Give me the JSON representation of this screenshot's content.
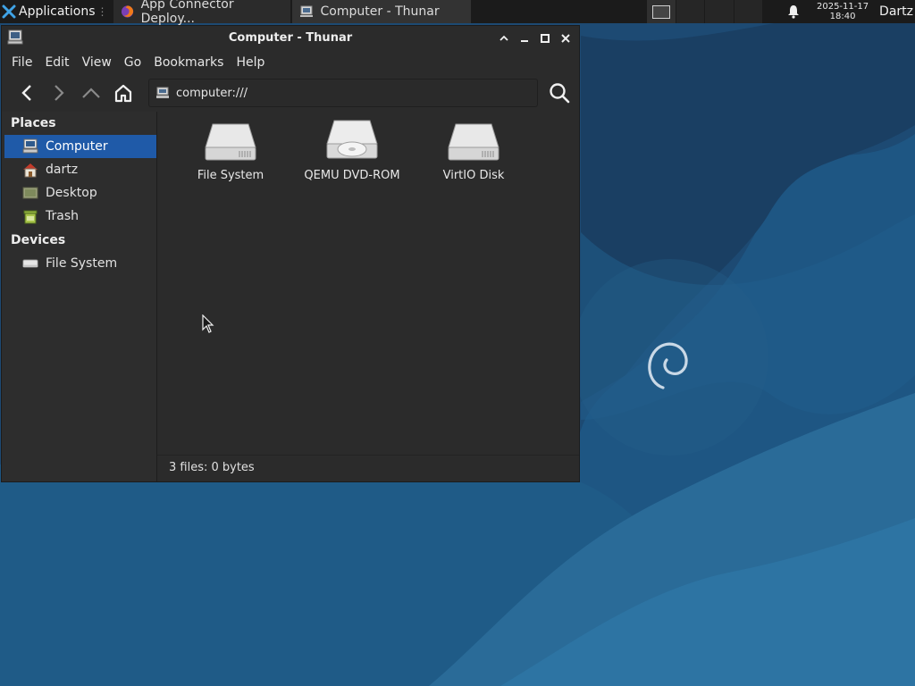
{
  "colors": {
    "panel": "#1b1b1b",
    "window_bg": "#2b2b2b",
    "selection": "#1f5aa8",
    "desktop": "#1f5a85"
  },
  "panel": {
    "applications_label": "Applications",
    "tasks": [
      {
        "label": "App Connector Deploy...",
        "icon": "firefox-icon"
      },
      {
        "label": "Computer - Thunar",
        "icon": "computer-icon"
      }
    ],
    "clock_date": "2025-11-17",
    "clock_time": "18:40",
    "user": "Dartz"
  },
  "window": {
    "title": "Computer - Thunar",
    "menu": [
      "File",
      "Edit",
      "View",
      "Go",
      "Bookmarks",
      "Help"
    ],
    "location_value": "computer:///"
  },
  "sidebar": {
    "places_heading": "Places",
    "places": [
      {
        "label": "Computer",
        "icon": "computer-icon",
        "selected": true
      },
      {
        "label": "dartz",
        "icon": "home-icon"
      },
      {
        "label": "Desktop",
        "icon": "desktop-icon"
      },
      {
        "label": "Trash",
        "icon": "trash-icon"
      }
    ],
    "devices_heading": "Devices",
    "devices": [
      {
        "label": "File System",
        "icon": "drive-icon"
      }
    ]
  },
  "files": [
    {
      "label": "File System",
      "icon": "harddisk-icon"
    },
    {
      "label": "QEMU DVD-ROM",
      "icon": "optical-drive-icon"
    },
    {
      "label": "VirtIO Disk",
      "icon": "harddisk-icon"
    }
  ],
  "status": "3 files: 0 bytes"
}
